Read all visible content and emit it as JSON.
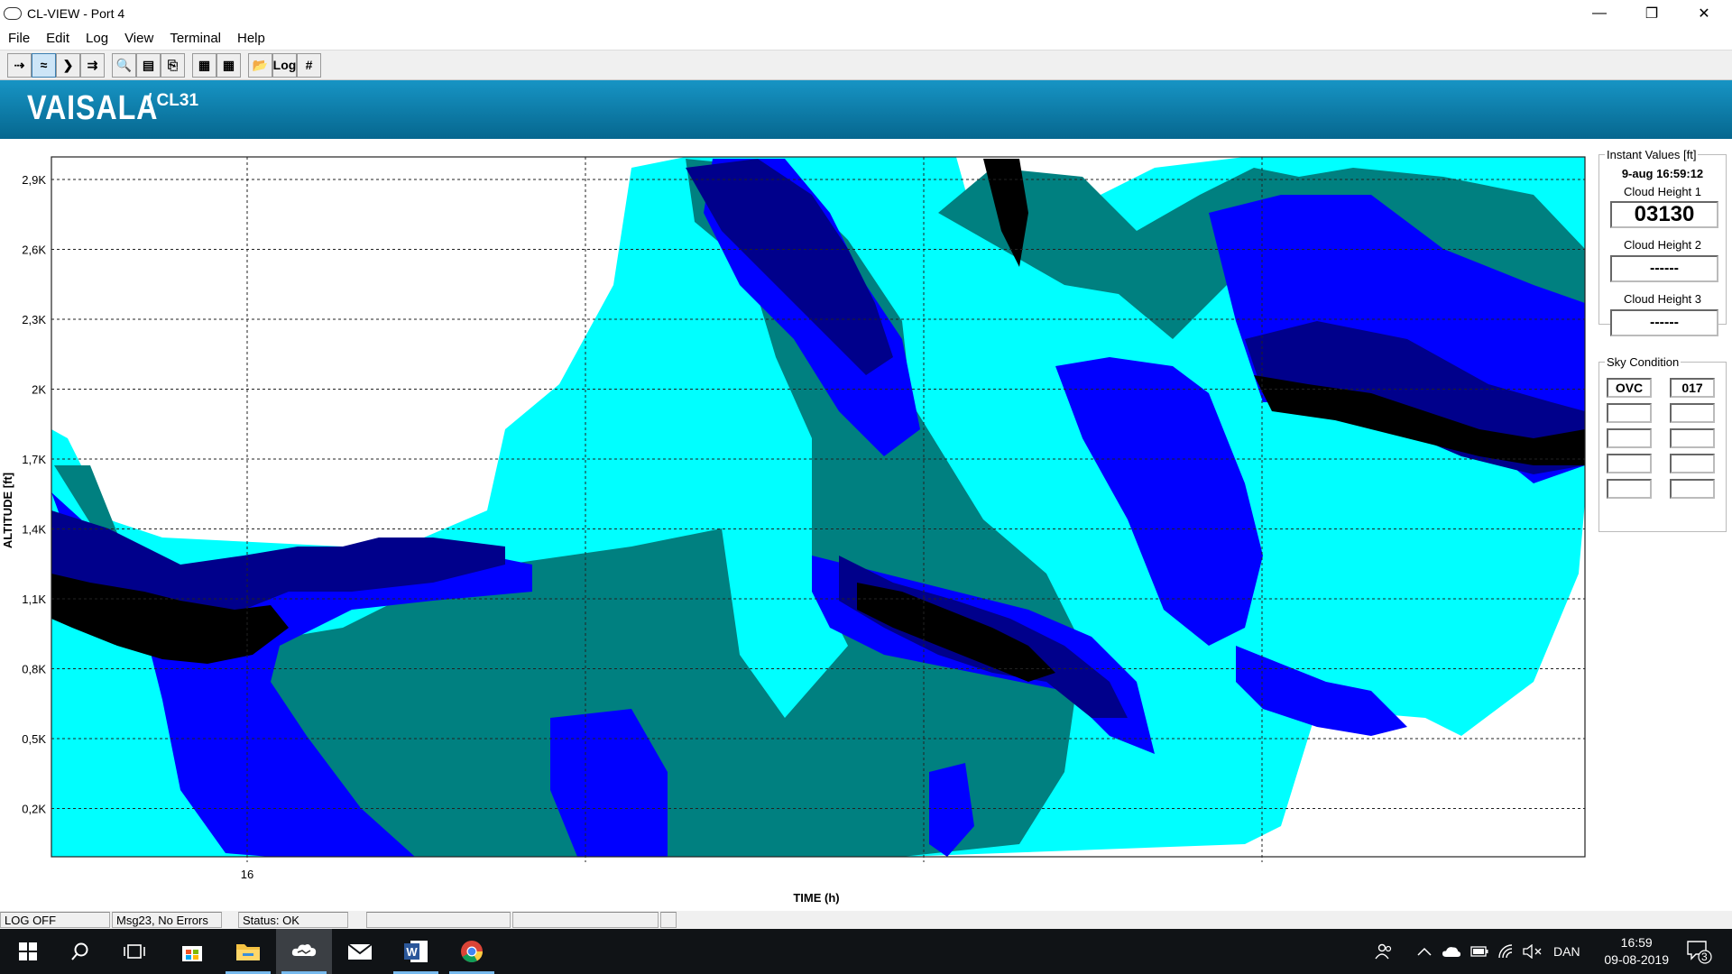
{
  "window": {
    "title": "CL-VIEW - Port 4",
    "minimize": "—",
    "restore": "❐",
    "close": "✕"
  },
  "menu": [
    "File",
    "Edit",
    "Log",
    "View",
    "Terminal",
    "Help"
  ],
  "toolbar": {
    "buttons": [
      "⇢",
      "≈",
      "❯",
      "⇉",
      "🔍",
      "▤",
      "⎘",
      "▦",
      "▦",
      "📂",
      "Log",
      "#"
    ]
  },
  "banner": {
    "brand": "VAISALA",
    "model": "/ CL31"
  },
  "chart_data": {
    "type": "heatmap",
    "ylabel": "ALTITUDE [ft]",
    "xlabel": "TIME (h)",
    "y_ticks": [
      "2,9K",
      "2,6K",
      "2,3K",
      "2K",
      "1,7K",
      "1,4K",
      "1,1K",
      "0,8K",
      "0,5K",
      "0,2K"
    ],
    "x_ticks": [
      "16"
    ],
    "colors": [
      "#ffffff",
      "#00ffff",
      "#008080",
      "#0000ff",
      "#00008b",
      "#000000"
    ]
  },
  "instant": {
    "title": "Instant Values [ft]",
    "datetime": "9-aug 16:59:12",
    "ch1_label": "Cloud Height 1",
    "ch1_value": "03130",
    "ch2_label": "Cloud Height 2",
    "ch2_value": "------",
    "ch3_label": "Cloud Height 3",
    "ch3_value": "------"
  },
  "sky": {
    "title": "Sky Condition",
    "rows": [
      [
        "OVC",
        "017"
      ],
      [
        "",
        ""
      ],
      [
        "",
        ""
      ],
      [
        "",
        ""
      ],
      [
        "",
        ""
      ]
    ]
  },
  "status": {
    "log": "LOG OFF",
    "msg": "Msg23, No Errors",
    "state": "Status: OK"
  },
  "taskbar": {
    "lang": "DAN",
    "time": "16:59",
    "date": "09-08-2019",
    "notifications": "3"
  }
}
